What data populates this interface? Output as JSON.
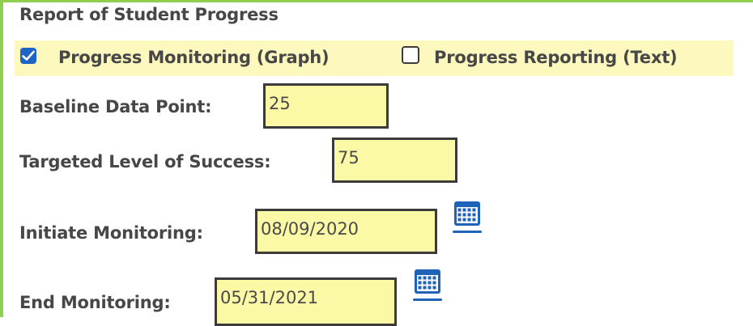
{
  "section": {
    "title": "Report of Student Progress"
  },
  "options": [
    {
      "label": "Progress Monitoring (Graph)",
      "checked": true
    },
    {
      "label": "Progress Reporting (Text)",
      "checked": false
    }
  ],
  "fields": {
    "baseline": {
      "label": "Baseline Data Point:",
      "value": "25"
    },
    "target": {
      "label": "Targeted Level of Success:",
      "value": "75"
    },
    "initiate": {
      "label": "Initiate Monitoring:",
      "value": "08/09/2020",
      "icon": "calendar-icon"
    },
    "end": {
      "label": "End Monitoring:",
      "value": "05/31/2021",
      "icon": "calendar-icon"
    }
  },
  "colors": {
    "accent_green": "#8fd14f",
    "highlight_yellow": "#fdf8bd",
    "input_yellow": "#fcf9a6",
    "checkbox_blue": "#1d64c6",
    "calendar_blue": "#1f63b8"
  }
}
